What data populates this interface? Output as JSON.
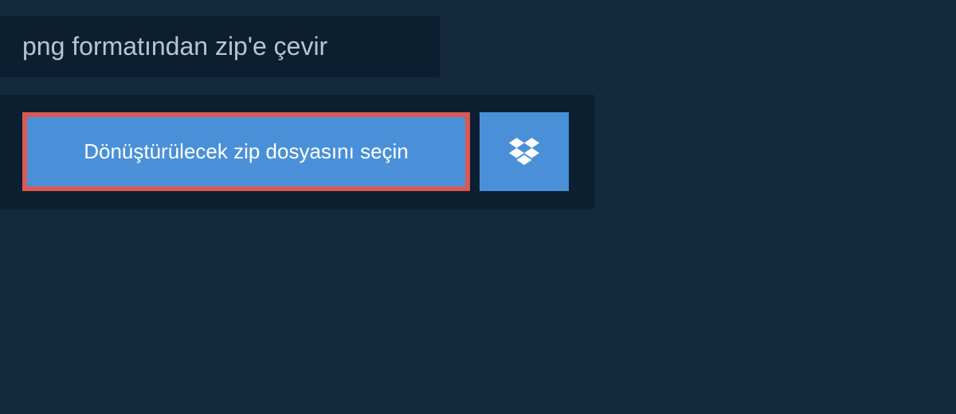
{
  "header": {
    "title": "png formatından zip'e çevir"
  },
  "actions": {
    "select_file_label": "Dönüştürülecek zip dosyasını seçin",
    "dropbox_icon": "dropbox"
  },
  "colors": {
    "background": "#13293d",
    "panel": "#0c1f31",
    "button": "#4a90d9",
    "highlight_border": "#d85a52",
    "text_muted": "#b8c5d1",
    "text_white": "#ffffff"
  }
}
